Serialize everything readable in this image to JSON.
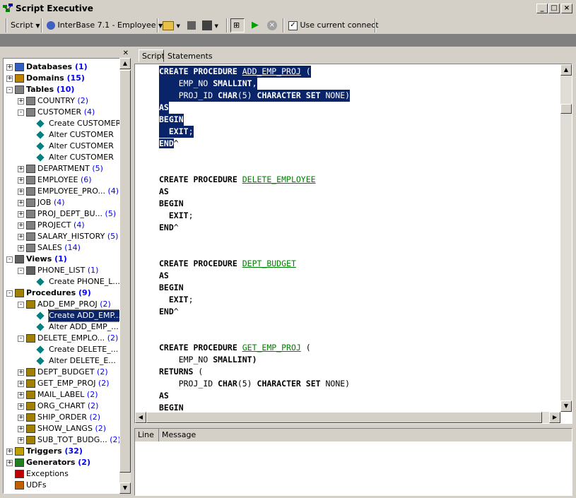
{
  "window": {
    "title": "Script Executive"
  },
  "toolbar": {
    "script_menu": "Script",
    "database_combo": "InterBase 7.1 - Employee",
    "use_current_connect": "Use current connect"
  },
  "tree": {
    "items": [
      {
        "label": "Databases",
        "count": "(1)"
      },
      {
        "label": "Domains",
        "count": "(15)"
      },
      {
        "label": "Tables",
        "count": "(10)"
      },
      {
        "label": "COUNTRY",
        "count": "(2)"
      },
      {
        "label": "CUSTOMER",
        "count": "(4)"
      },
      {
        "label": "Create CUSTOMER",
        "count": ""
      },
      {
        "label": "Alter CUSTOMER",
        "count": ""
      },
      {
        "label": "Alter CUSTOMER",
        "count": ""
      },
      {
        "label": "Alter CUSTOMER",
        "count": ""
      },
      {
        "label": "DEPARTMENT",
        "count": "(5)"
      },
      {
        "label": "EMPLOYEE",
        "count": "(6)"
      },
      {
        "label": "EMPLOYEE_PRO...",
        "count": "(4)"
      },
      {
        "label": "JOB",
        "count": "(4)"
      },
      {
        "label": "PROJ_DEPT_BU...",
        "count": "(5)"
      },
      {
        "label": "PROJECT",
        "count": "(4)"
      },
      {
        "label": "SALARY_HISTORY",
        "count": "(5)"
      },
      {
        "label": "SALES",
        "count": "(14)"
      },
      {
        "label": "Views",
        "count": "(1)"
      },
      {
        "label": "PHONE_LIST",
        "count": "(1)"
      },
      {
        "label": "Create PHONE_L...",
        "count": ""
      },
      {
        "label": "Procedures",
        "count": "(9)"
      },
      {
        "label": "ADD_EMP_PROJ",
        "count": "(2)"
      },
      {
        "label": "Create ADD_EMP...",
        "count": ""
      },
      {
        "label": "Alter ADD_EMP_...",
        "count": ""
      },
      {
        "label": "DELETE_EMPLO...",
        "count": "(2)"
      },
      {
        "label": "Create DELETE_...",
        "count": ""
      },
      {
        "label": "Alter DELETE_E...",
        "count": ""
      },
      {
        "label": "DEPT_BUDGET",
        "count": "(2)"
      },
      {
        "label": "GET_EMP_PROJ",
        "count": "(2)"
      },
      {
        "label": "MAIL_LABEL",
        "count": "(2)"
      },
      {
        "label": "ORG_CHART",
        "count": "(2)"
      },
      {
        "label": "SHIP_ORDER",
        "count": "(2)"
      },
      {
        "label": "SHOW_LANGS",
        "count": "(2)"
      },
      {
        "label": "SUB_TOT_BUDG...",
        "count": "(2)"
      },
      {
        "label": "Triggers",
        "count": "(32)"
      },
      {
        "label": "Generators",
        "count": "(2)"
      },
      {
        "label": "Exceptions",
        "count": ""
      },
      {
        "label": "UDFs",
        "count": ""
      }
    ]
  },
  "tabs": [
    "Script",
    "Statements"
  ],
  "code": {
    "kw_create": "CREATE PROCEDURE",
    "p1": "ADD_EMP_PROJ",
    "paren_open": " (",
    "emp_no": "EMP_NO",
    "smallint": "SMALLINT",
    "comma": ",",
    "proj_id": "PROJ_ID",
    "char5": "CHAR",
    "char5_arg": "(5)",
    "charset": "CHARACTER SET",
    "none": "NONE)",
    "as": "AS",
    "begin": "BEGIN",
    "exit": "EXIT",
    "semi": ";",
    "end": "END",
    "caret": "^",
    "p2": "DELETE_EMPLOYEE",
    "p3": "DEPT_BUDGET",
    "p4": "GET_EMP_PROJ",
    "smallint_close": "SMALLINT)",
    "returns": "RETURNS",
    "paren_only": " ("
  },
  "messages": {
    "col_line": "Line",
    "col_message": "Message"
  }
}
